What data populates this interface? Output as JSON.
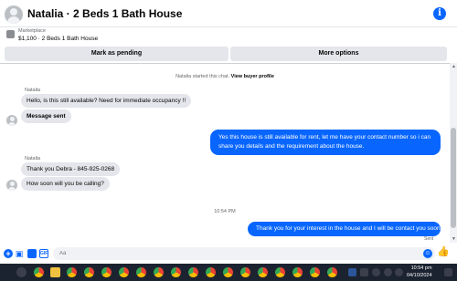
{
  "header": {
    "title": "Natalia · 2 Beds 1 Bath House",
    "info_icon": "info-icon"
  },
  "listing": {
    "source": "Marketplace",
    "title": "$1,100 · 2 Beds 1 Bath House"
  },
  "actions": {
    "pending_label": "Mark as pending",
    "more_label": "More options"
  },
  "chat": {
    "system_note_prefix": "Natalia started this chat.",
    "system_note_link": "View buyer profile",
    "group1": {
      "sender": "Natalia",
      "messages": [
        "Hello, is this still available? Need for immediate occupancy !!",
        "Message sent"
      ]
    },
    "outgoing1": "Yes this house is still available for rent, let me have your contact number so i can share you details and the requirement about the house.",
    "group2": {
      "sender": "Natalia",
      "messages": [
        "Thank you Debra - 845-925-0268",
        "How soon will you be calling?"
      ]
    },
    "timestamp": "10:54 PM",
    "outgoing2": "Thank you for your interest in the house and I will be contact you soon.",
    "sent_label": "Sent"
  },
  "composer": {
    "placeholder": "Aa"
  },
  "taskbar": {
    "time": "10:54 pm",
    "date": "04/10/2024"
  },
  "colors": {
    "accent": "#0866ff",
    "bubble_in": "#e4e6eb",
    "taskbar": "#1c2330"
  }
}
